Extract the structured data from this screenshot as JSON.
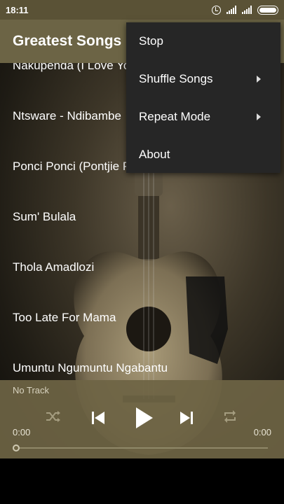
{
  "status_bar": {
    "time": "18:11",
    "icons": [
      "alarm-icon",
      "signal-icon",
      "signal-icon",
      "battery-icon"
    ]
  },
  "app_bar": {
    "title": "Greatest Songs"
  },
  "songs": [
    "Nakupenda (I Love You)",
    "Ntsware - Ndibambe",
    "Ponci Ponci (Pontjie Pontjie)",
    "Sum' Bulala",
    "Thola Amadlozi",
    "Too Late For Mama",
    "Umuntu Ngumuntu Ngabantu"
  ],
  "menu": {
    "items": [
      {
        "label": "Stop",
        "has_submenu": false
      },
      {
        "label": "Shuffle Songs",
        "has_submenu": true
      },
      {
        "label": "Repeat Mode",
        "has_submenu": true
      },
      {
        "label": "About",
        "has_submenu": false
      }
    ]
  },
  "player": {
    "track": "No Track",
    "time_current": "0:00",
    "time_total": "0:00",
    "progress": 0,
    "controls": [
      "shuffle-icon",
      "previous-icon",
      "play-icon",
      "next-icon",
      "repeat-icon"
    ]
  },
  "colors": {
    "status_bar": "#5a5236",
    "app_bar": "#6c6445",
    "menu_bg": "#262626",
    "player_bg": "#6e6444"
  }
}
